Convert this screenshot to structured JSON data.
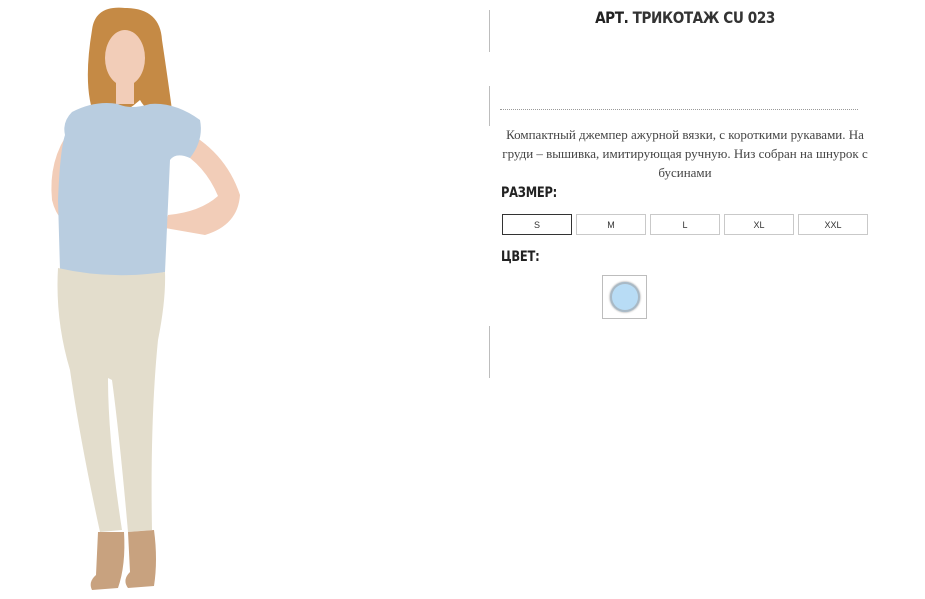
{
  "product": {
    "title_prefix": "АРТ.",
    "title_name": "ТРИКОТАЖ CU 023",
    "description": "Компактный джемпер ажурной вязки, с короткими рукавами. На груди – вышивка, имитирующая ручную. Низ собран на шнурок с бусинами",
    "size_label": "РАЗМЕР:",
    "color_label": "ЦВЕТ:",
    "sizes": [
      "S",
      "M",
      "L",
      "XL",
      "XXL"
    ],
    "selected_size": "S",
    "swatch_color": "#b8dcf5",
    "photo": {
      "shirt_color": "#b9cde0",
      "pants_color": "#e3ddcc",
      "hair_color": "#c58a45",
      "skin_color": "#f2cdb8"
    }
  }
}
